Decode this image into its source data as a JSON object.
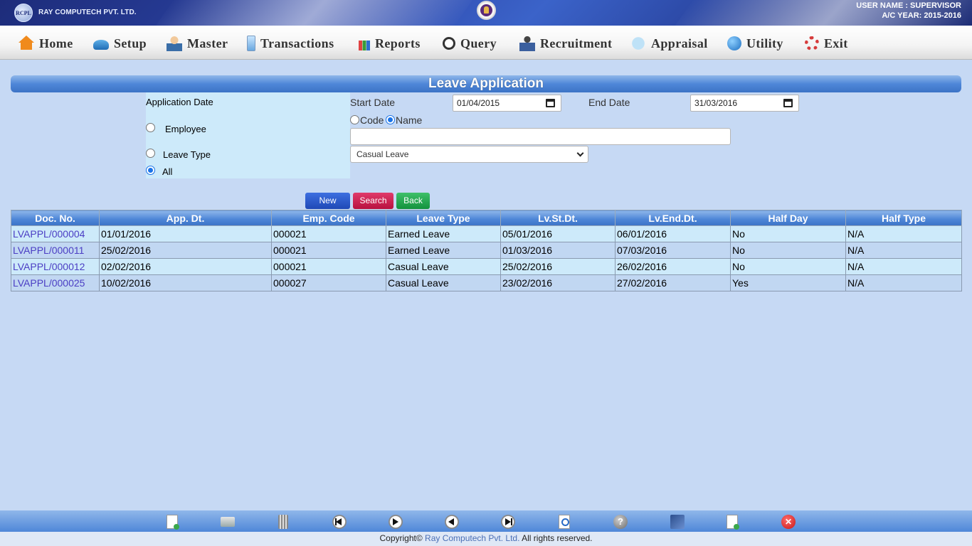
{
  "header": {
    "logo_text": "RCPL",
    "company": "RAY COMPUTECH PVT. LTD.",
    "user_line": "USER NAME : SUPERVISOR",
    "year_line": "A/C YEAR: 2015-2016"
  },
  "menu": [
    {
      "label": "Home",
      "icon": "home-icon"
    },
    {
      "label": "Setup",
      "icon": "setup-icon"
    },
    {
      "label": "Master",
      "icon": "master-icon"
    },
    {
      "label": "Transactions",
      "icon": "transactions-icon"
    },
    {
      "label": "Reports",
      "icon": "reports-icon"
    },
    {
      "label": "Query",
      "icon": "query-icon"
    },
    {
      "label": "Recruitment",
      "icon": "recruitment-icon"
    },
    {
      "label": "Appraisal",
      "icon": "appraisal-icon"
    },
    {
      "label": "Utility",
      "icon": "utility-icon"
    },
    {
      "label": "Exit",
      "icon": "exit-icon"
    }
  ],
  "page_title": "Leave Application",
  "filter": {
    "application_date_label": "Application Date",
    "employee_label": "Employee",
    "leave_type_label": "Leave Type",
    "all_label": "All",
    "selected_option": "All",
    "start_date_label": "Start Date",
    "start_date_value": "01/04/2015",
    "end_date_label": "End Date",
    "end_date_value": "31/03/2016",
    "code_label": "Code",
    "name_label": "Name",
    "search_by": "Name",
    "name_value": "",
    "leave_type_value": "Casual Leave"
  },
  "buttons": {
    "new": "New",
    "search": "Search",
    "back": "Back"
  },
  "table": {
    "columns": [
      "Doc. No.",
      "App. Dt.",
      "Emp. Code",
      "Leave Type",
      "Lv.St.Dt.",
      "Lv.End.Dt.",
      "Half Day",
      "Half Type"
    ],
    "rows": [
      [
        "LVAPPL/000004",
        "01/01/2016",
        "000021",
        "Earned Leave",
        "05/01/2016",
        "06/01/2016",
        "No",
        "N/A"
      ],
      [
        "LVAPPL/000011",
        "25/02/2016",
        "000021",
        "Earned Leave",
        "01/03/2016",
        "07/03/2016",
        "No",
        "N/A"
      ],
      [
        "LVAPPL/000012",
        "02/02/2016",
        "000021",
        "Casual Leave",
        "25/02/2016",
        "26/02/2016",
        "No",
        "N/A"
      ],
      [
        "LVAPPL/000025",
        "10/02/2016",
        "000027",
        "Casual Leave",
        "23/02/2016",
        "27/02/2016",
        "Yes",
        "N/A"
      ]
    ]
  },
  "toolbar_icons": [
    "new-doc-icon",
    "save-icon",
    "delete-icon",
    "first-record-icon",
    "next-record-icon",
    "previous-record-icon",
    "last-record-icon",
    "find-icon",
    "help-icon",
    "edit-icon",
    "add-doc-icon",
    "close-icon"
  ],
  "footer": {
    "prefix": "Copyright©",
    "brand": "Ray Computech Pvt. Ltd.",
    "suffix": "All rights reserved."
  },
  "colors": {
    "accent_blue": "#3c73c6",
    "background": "#c6d9f4",
    "new_button": "#1f49b6",
    "search_button": "#b8123f",
    "back_button": "#13923d",
    "link": "#4b3ec4"
  }
}
